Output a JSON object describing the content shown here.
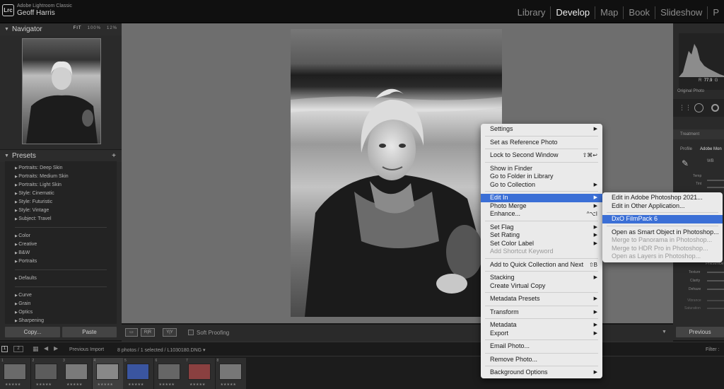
{
  "app": {
    "name": "Adobe Lightroom Classic",
    "logo": "Lrc",
    "user": "Geoff Harris"
  },
  "modules": [
    {
      "label": "Library",
      "active": false
    },
    {
      "label": "Develop",
      "active": true
    },
    {
      "label": "Map",
      "active": false
    },
    {
      "label": "Book",
      "active": false
    },
    {
      "label": "Slideshow",
      "active": false
    },
    {
      "label": "P",
      "active": false
    }
  ],
  "navigator": {
    "title": "Navigator",
    "zoom_options": [
      "FIT",
      "100%",
      "12%"
    ]
  },
  "presets": {
    "title": "Presets",
    "add_icon": "+",
    "groups": [
      [
        "Portraits: Deep Skin",
        "Portraits: Medium Skin",
        "Portraits: Light Skin",
        "Style: Cinematic",
        "Style: Futuristic",
        "Style: Vintage",
        "Subject: Travel"
      ],
      [
        "Color",
        "Creative",
        "B&W",
        "Portraits"
      ],
      [
        "Defaults"
      ],
      [
        "Curve",
        "Grain",
        "Optics",
        "Sharpening"
      ]
    ]
  },
  "left_buttons": {
    "copy": "Copy...",
    "paste": "Paste"
  },
  "toolbar": {
    "soft_proofing": "Soft Proofing",
    "view_icons": [
      "▭",
      "R|R",
      "Y|Y"
    ]
  },
  "right_panel": {
    "rgb_r": "R",
    "rgb_val": "77.9",
    "rgb_g": "G",
    "original_photo": "Original Photo",
    "treatment": "Treatment",
    "profile_label": "Profile",
    "profile_value": "Adobe Mon",
    "wb": "WB",
    "temp": "Temp",
    "tint": "Tint",
    "presence": "Presence",
    "texture": "Texture",
    "clarity": "Clarity",
    "dehaze": "Dehaze",
    "vibrance": "Vibrance",
    "saturation": "Saturation",
    "previous_button": "Previous"
  },
  "filmstrip_bar": {
    "screen1": "1",
    "screen2": "2",
    "source": "Previous Import",
    "status": "8 photos / 1 selected / L1030180.DNG",
    "filter": "Filter :"
  },
  "filmstrip": [
    {
      "num": "1",
      "stars": "★★★★★",
      "selected": false
    },
    {
      "num": "2",
      "stars": "★★★★★",
      "selected": false
    },
    {
      "num": "3",
      "stars": "★★★★★",
      "selected": false
    },
    {
      "num": "4",
      "stars": "★★★★★",
      "selected": true
    },
    {
      "num": "5",
      "stars": "★★★★★",
      "selected": false
    },
    {
      "num": "6",
      "stars": "★★★★★",
      "selected": false
    },
    {
      "num": "7",
      "stars": "★★★★★",
      "selected": false
    },
    {
      "num": "8",
      "stars": "★★★★★",
      "selected": false
    }
  ],
  "context_menu": [
    {
      "label": "Settings",
      "arrow": true
    },
    {
      "sep": true
    },
    {
      "label": "Set as Reference Photo"
    },
    {
      "sep": true
    },
    {
      "label": "Lock to Second Window",
      "shortcut": "⇧⌘↩"
    },
    {
      "sep": true
    },
    {
      "label": "Show in Finder"
    },
    {
      "label": "Go to Folder in Library"
    },
    {
      "label": "Go to Collection",
      "arrow": true
    },
    {
      "sep": true
    },
    {
      "label": "Edit In",
      "arrow": true,
      "highlight": true
    },
    {
      "label": "Photo Merge",
      "arrow": true
    },
    {
      "label": "Enhance...",
      "shortcut": "^⌥I"
    },
    {
      "sep": true
    },
    {
      "label": "Set Flag",
      "arrow": true
    },
    {
      "label": "Set Rating",
      "arrow": true
    },
    {
      "label": "Set Color Label",
      "arrow": true
    },
    {
      "label": "Add Shortcut Keyword",
      "disabled": true
    },
    {
      "sep": true
    },
    {
      "label": "Add to Quick Collection and Next",
      "shortcut": "⇧B"
    },
    {
      "sep": true
    },
    {
      "label": "Stacking",
      "arrow": true
    },
    {
      "label": "Create Virtual Copy"
    },
    {
      "sep": true
    },
    {
      "label": "Metadata Presets",
      "arrow": true
    },
    {
      "sep": true
    },
    {
      "label": "Transform",
      "arrow": true
    },
    {
      "sep": true
    },
    {
      "label": "Metadata",
      "arrow": true
    },
    {
      "label": "Export",
      "arrow": true
    },
    {
      "sep": true
    },
    {
      "label": "Email Photo..."
    },
    {
      "sep": true
    },
    {
      "label": "Remove Photo..."
    },
    {
      "sep": true
    },
    {
      "label": "Background Options",
      "arrow": true
    }
  ],
  "submenu": [
    {
      "label": "Edit in Adobe Photoshop 2021..."
    },
    {
      "label": "Edit in Other Application..."
    },
    {
      "sep": true
    },
    {
      "label": "DxO FilmPack 6",
      "highlight": true
    },
    {
      "sep": true
    },
    {
      "label": "Open as Smart Object in Photoshop..."
    },
    {
      "label": "Merge to Panorama in Photoshop...",
      "disabled": true
    },
    {
      "label": "Merge to HDR Pro in Photoshop...",
      "disabled": true
    },
    {
      "label": "Open as Layers in Photoshop...",
      "disabled": true
    }
  ]
}
